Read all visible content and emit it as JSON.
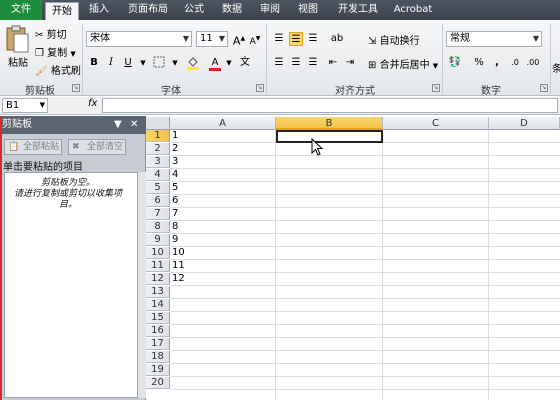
{
  "tabs": [
    "文件",
    "开始",
    "插入",
    "页面布局",
    "公式",
    "数据",
    "审阅",
    "视图",
    "开发工具",
    "Acrobat"
  ],
  "ribbon": {
    "clipboard": {
      "paste": "粘贴",
      "cut": "剪切",
      "copy": "复制",
      "format_painter": "格式刷",
      "label": "剪贴板"
    },
    "font": {
      "name": "宋体",
      "size": "11",
      "label": "字体",
      "bold": "B",
      "italic": "I",
      "underline": "U"
    },
    "alignment": {
      "wrap": "自动换行",
      "merge": "合并后居中",
      "label": "对齐方式"
    },
    "number": {
      "format": "常规",
      "label": "数字",
      "percent": "%",
      "comma": ","
    },
    "styles": {
      "partial": "条"
    }
  },
  "formula_bar": {
    "name_box": "B1",
    "fx": "fx",
    "value": ""
  },
  "clipboard_pane": {
    "title": "剪贴板",
    "paste_all": "全部粘贴",
    "clear_all": "全部清空",
    "hint": "单击要粘贴的项目",
    "empty_msg": "剪贴板为空。\n请进行复制或剪切以收集项目。"
  },
  "grid": {
    "columns": [
      "A",
      "B",
      "C",
      "D"
    ],
    "selected_column": "B",
    "selected_row": 1,
    "rows": [
      "1",
      "2",
      "3",
      "4",
      "5",
      "6",
      "7",
      "8",
      "9",
      "10",
      "11",
      "12",
      "13",
      "14",
      "15",
      "16",
      "17",
      "18",
      "19",
      "20"
    ],
    "col_a_values": [
      "1",
      "2",
      "3",
      "4",
      "5",
      "6",
      "7",
      "8",
      "9",
      "10",
      "11",
      "12"
    ]
  }
}
